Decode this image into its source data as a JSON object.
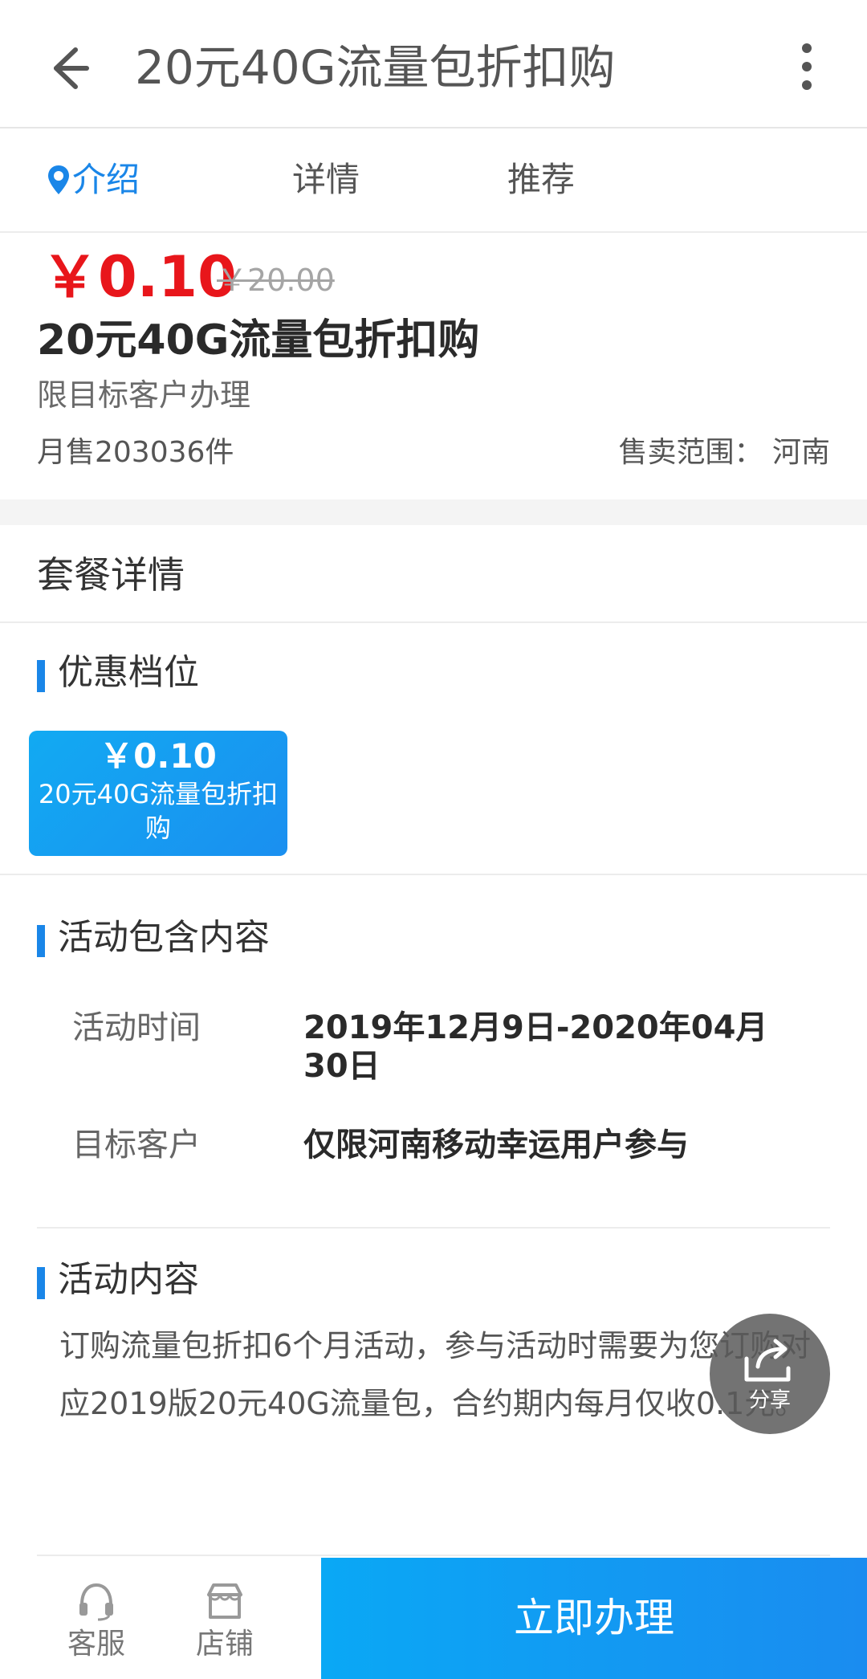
{
  "header": {
    "title": "20元40G流量包折扣购",
    "back_icon": "back-arrow-icon",
    "more_icon": "more-vertical-icon"
  },
  "tabs": [
    {
      "label": "介绍",
      "active": true,
      "icon": "location-pin-icon"
    },
    {
      "label": "详情",
      "active": false
    },
    {
      "label": "推荐",
      "active": false
    }
  ],
  "product": {
    "price": "￥0.10",
    "original_price": "￥20.00",
    "title": "20元40G流量包折扣购",
    "subtitle": "限目标客户办理",
    "monthly_sales": "月售203036件",
    "sale_range": "售卖范围：  河南"
  },
  "package_details": {
    "title": "套餐详情"
  },
  "tier_section": {
    "title": "优惠档位",
    "tiers": [
      {
        "price": "￥0.10",
        "name": "20元40G流量包折扣购"
      }
    ]
  },
  "activity_section": {
    "title": "活动包含内容",
    "rows": [
      {
        "label": "活动时间",
        "value": "2019年12月9日-2020年04月30日"
      },
      {
        "label": "目标客户",
        "value": "仅限河南移动幸运用户参与"
      }
    ]
  },
  "activity_content": {
    "title": "活动内容",
    "text": "订购流量包折扣6个月活动，参与活动时需要为您订购对应2019版20元40G流量包，合约期内每月仅收0.1元。"
  },
  "share": {
    "label": "分享",
    "icon": "share-icon"
  },
  "bottom_bar": {
    "service_label": "客服",
    "service_icon": "headset-icon",
    "store_label": "店铺",
    "store_icon": "store-icon",
    "apply_label": "立即办理"
  },
  "colors": {
    "accent": "#1a86e8",
    "price_red": "#e8161b",
    "button_blue": "#0aa8f5"
  }
}
